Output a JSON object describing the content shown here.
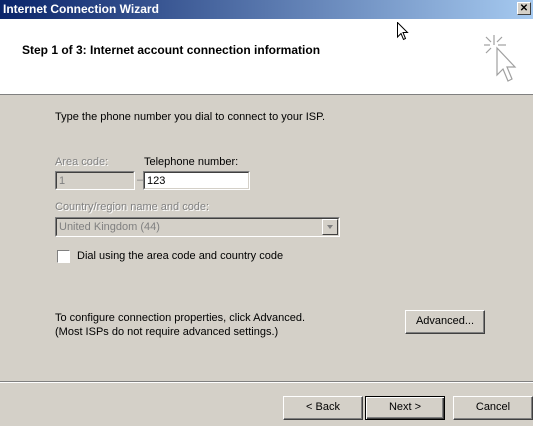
{
  "window": {
    "title": "Internet Connection Wizard",
    "close_glyph": "✕"
  },
  "header": {
    "step_title": "Step 1 of 3: Internet account connection information",
    "icon": "wizard-sparkle-icon"
  },
  "body": {
    "instruction": "Type the phone number you dial to connect to your ISP.",
    "area_code": {
      "label": "Area code:",
      "value": "1"
    },
    "dash": "–",
    "telephone": {
      "label": "Telephone number:",
      "value": "123"
    },
    "country": {
      "label": "Country/region name and code:",
      "value": "United Kingdom (44)"
    },
    "dial_checkbox": {
      "label": "Dial using the area code and country code",
      "checked": false
    },
    "advanced_text_1": "To configure connection properties, click Advanced.",
    "advanced_text_2": "(Most ISPs do not require advanced settings.)",
    "advanced_button": "Advanced..."
  },
  "footer": {
    "back_button": "< Back",
    "next_button": "Next >",
    "cancel_button": "Cancel"
  }
}
